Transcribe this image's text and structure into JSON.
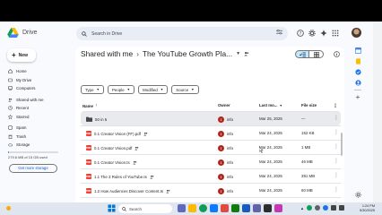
{
  "app": {
    "name": "Drive"
  },
  "search": {
    "placeholder": "Search in Drive"
  },
  "new_button": {
    "label": "New"
  },
  "nav": {
    "items": [
      {
        "label": "Home",
        "icon": "home-icon"
      },
      {
        "label": "My Drive",
        "icon": "drive-icon"
      },
      {
        "label": "Computers",
        "icon": "computer-icon"
      },
      {
        "label": "Shared with me",
        "icon": "people-icon"
      },
      {
        "label": "Recent",
        "icon": "clock-icon"
      },
      {
        "label": "Starred",
        "icon": "star-icon"
      },
      {
        "label": "Spam",
        "icon": "spam-icon"
      },
      {
        "label": "Trash",
        "icon": "trash-icon"
      },
      {
        "label": "Storage",
        "icon": "cloud-icon"
      }
    ],
    "storage_text": "279.6 MB of 15 GB used",
    "storage_fraction": 0.018,
    "get_more_label": "Get more storage"
  },
  "breadcrumb": {
    "parent": "Shared with me",
    "current": "The YouTube Growth Pla..."
  },
  "filters": [
    "Type",
    "People",
    "Modified",
    "Source"
  ],
  "columns": {
    "name": "Name",
    "owner": "Owner",
    "modified": "Last mo...",
    "size": "File size"
  },
  "rows": [
    {
      "name": "50 in 5",
      "type": "folder",
      "owner": "info",
      "modified": "Mar 25, 2025",
      "size": "—"
    },
    {
      "name": "0.1 Creator Vision (FF).pdf",
      "type": "pdf",
      "owner": "info",
      "modified": "Mar 24, 2025",
      "size": "152 KB"
    },
    {
      "name": "0.1 Creator Vision.pdf",
      "type": "pdf",
      "owner": "info",
      "modified": "Mar 24, 2025",
      "size": "1 MB"
    },
    {
      "name": "0.1 Creator Vision.ts",
      "type": "pdf",
      "owner": "info",
      "modified": "Mar 24, 2025",
      "size": "46 MB"
    },
    {
      "name": "1.1 The 3 Rules of YouTube.ts",
      "type": "pdf",
      "owner": "info",
      "modified": "Mar 24, 2025",
      "size": "391 MB"
    },
    {
      "name": "1.2 How Audiences Discover Content.ts",
      "type": "pdf",
      "owner": "info",
      "modified": "Mar 24, 2025",
      "size": "60 MB"
    },
    {
      "name": "1.3 Audience Audit (FF).pdf",
      "type": "pdf",
      "owner": "info",
      "modified": "Mar 24, 2025",
      "size": "510 KB"
    }
  ],
  "taskbar": {
    "weather": "Search",
    "search_placeholder": "Search",
    "time": "1:24 PM",
    "date": "5/30/2025"
  },
  "colors": {
    "accent": "#0b57d0",
    "selected": "#c2e7ff",
    "pdf": "#ea4335",
    "owner": "#b3261e"
  }
}
